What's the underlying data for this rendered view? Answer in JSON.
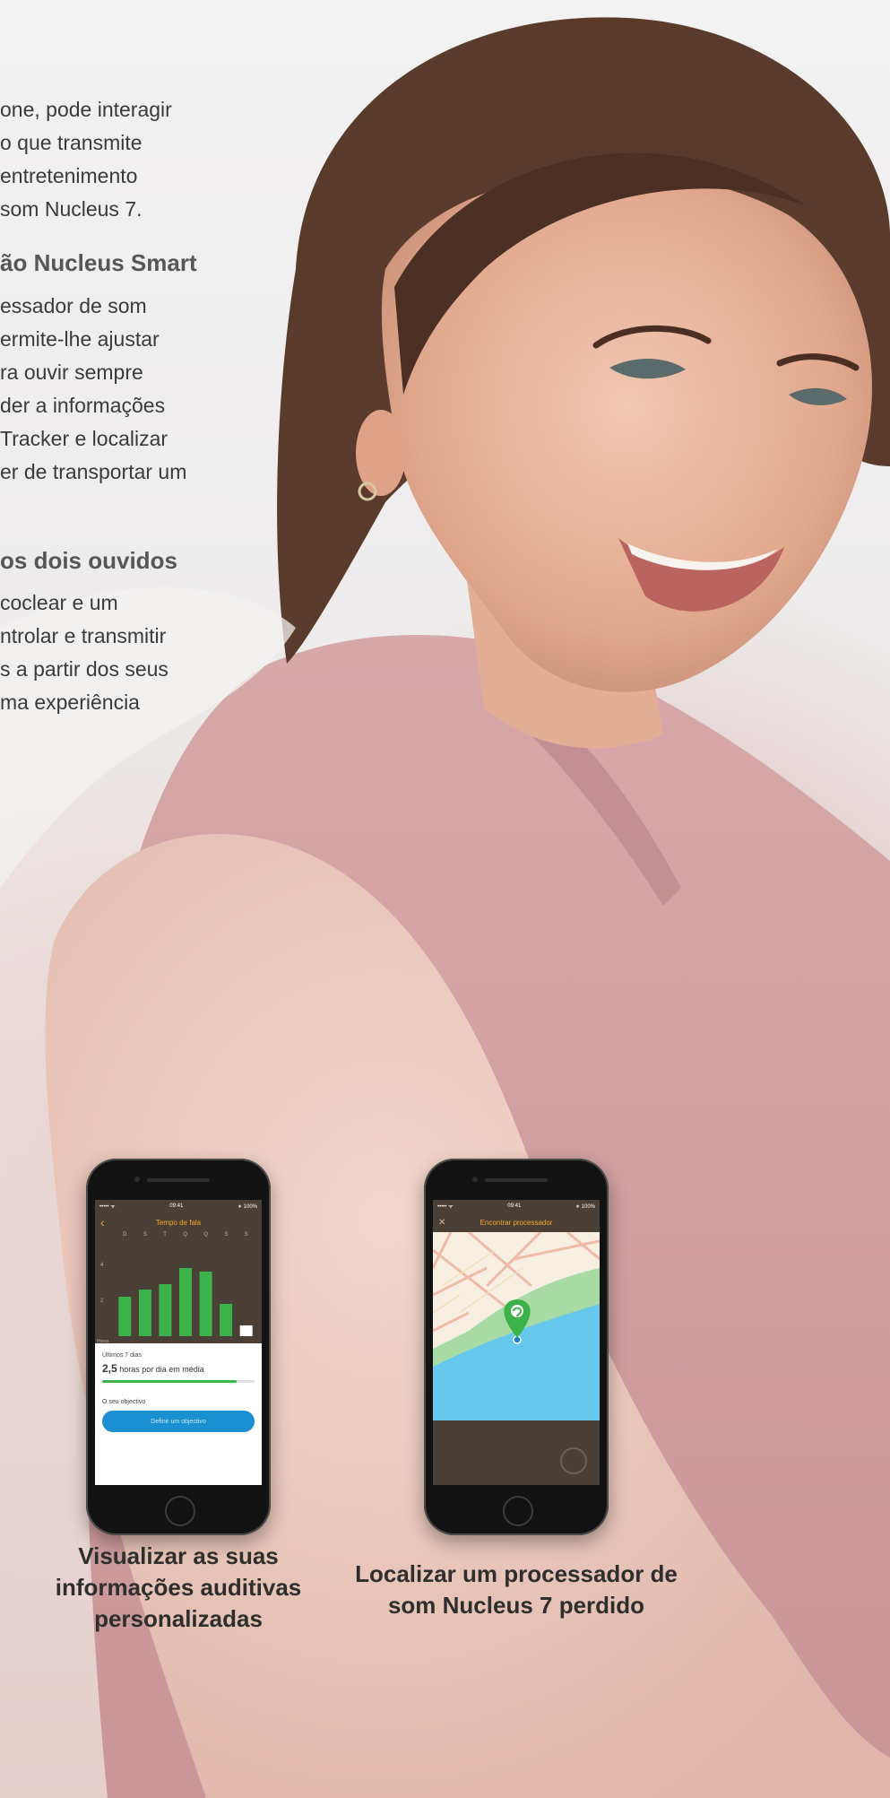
{
  "intro_lines": [
    "one, pode interagir",
    "o que transmite",
    "entretenimento",
    "som Nucleus 7."
  ],
  "section_app": {
    "heading": "ão Nucleus Smart",
    "lines": [
      "essador de som",
      "ermite-lhe ajustar",
      "ra ouvir sempre",
      "der a informações",
      "Tracker e localizar",
      "er de transportar um"
    ]
  },
  "section_bimodal": {
    "heading": "os dois ouvidos",
    "lines": [
      "coclear e um",
      "ntrolar e transmitir",
      "s a partir dos seus",
      "ma experiência"
    ]
  },
  "phone_tracker": {
    "status_left": "••••• ᯤ",
    "status_time": "09:41",
    "status_right": "∗ 100%",
    "back_icon": "chevron-left-icon",
    "title": "Tempo de fala",
    "days": [
      "D",
      "S",
      "T",
      "Q",
      "Q",
      "S",
      "S"
    ],
    "y_labels": [
      "4",
      "2"
    ],
    "axis_caption": "Horas",
    "bar_color": "#3bb34a",
    "bars": [
      2.2,
      2.6,
      2.9,
      3.8,
      3.6,
      1.8,
      0.6
    ],
    "panel_label": "Últimos 7 dias",
    "panel_value": "2,5",
    "panel_value_suffix": "horas por dia em média",
    "goal_label": "O seu objectivo",
    "goal_button": "Definir um objectivo",
    "caption_lines": [
      "Visualizar as suas",
      "informações auditivas",
      "personalizadas"
    ]
  },
  "phone_finder": {
    "status_left": "••••• ᯤ",
    "status_time": "09:41",
    "status_right": "∗ 100%",
    "close_icon": "close-icon",
    "title": "Encontrar processador",
    "map_pin": "map-pin-icon",
    "caption_lines": [
      "Localizar um processador de",
      "som Nucleus 7 perdido"
    ]
  }
}
